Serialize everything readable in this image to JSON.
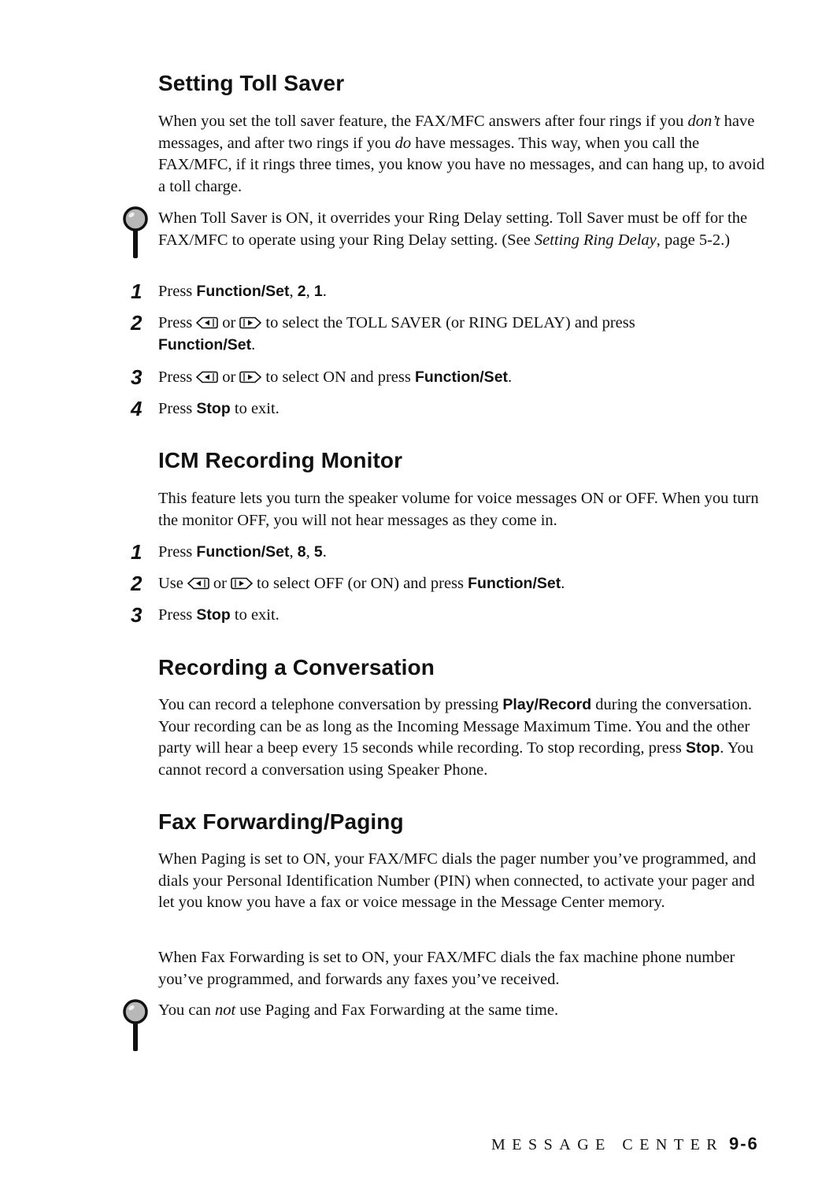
{
  "sections": [
    {
      "title": "Setting Toll Saver",
      "intro": {
        "p1": "When you set the toll saver feature, the FAX/MFC answers after four rings if you ",
        "em1": "don’t",
        "p2": " have messages, and after two rings if you ",
        "em2": "do",
        "p3": " have messages. This way, when you call the FAX/MFC, if it rings three times, you know you have no messages, and can hang up, to avoid a toll charge."
      },
      "note": {
        "p1": "When Toll Saver is ON, it overrides your Ring Delay setting. Toll Saver must be off for the FAX/MFC to operate using your Ring Delay setting. (See ",
        "em": "Setting Ring Delay",
        "p2": ", page 5-2.)"
      },
      "steps": [
        {
          "num": "1",
          "pre": "Press ",
          "bold": "Function/Set",
          "mid": ", ",
          "bold2": "2",
          "mid2": ", ",
          "bold3": "1",
          "post": "."
        },
        {
          "num": "2",
          "pre": "Press",
          "or": "or",
          "mid": "to select the TOLL SAVER (or RING DELAY) and press",
          "bold": "Function/Set",
          "post": "."
        },
        {
          "num": "3",
          "pre": "Press",
          "or": "or",
          "mid": "to select ON and press ",
          "bold": "Function/Set",
          "post": "."
        },
        {
          "num": "4",
          "pre": "Press ",
          "bold": "Stop",
          "post": " to exit."
        }
      ]
    },
    {
      "title": "ICM Recording Monitor",
      "intro": "This feature lets you turn the speaker volume for voice messages ON or OFF. When you turn the monitor OFF, you will not hear messages as they come in.",
      "steps": [
        {
          "num": "1",
          "pre": "Press ",
          "bold": "Function/Set",
          "mid": ", ",
          "bold2": "8",
          "mid2": ", ",
          "bold3": "5",
          "post": "."
        },
        {
          "num": "2",
          "pre": "Use",
          "or": "or",
          "mid": "to select OFF (or ON) and press ",
          "bold": "Function/Set",
          "post": "."
        },
        {
          "num": "3",
          "pre": "Press ",
          "bold": "Stop",
          "post": " to exit."
        }
      ]
    },
    {
      "title": "Recording a Conversation",
      "body": {
        "p1": "You can record a telephone conversation by pressing ",
        "b1": "Play/Record",
        "p2": " during the conversation. Your recording can be as long as the Incoming Message Maximum Time. You and the other party will hear a beep every 15 seconds while recording. To stop recording, press ",
        "b2": "Stop",
        "p3": ". You cannot record a conversation using Speaker Phone."
      }
    },
    {
      "title": "Fax Forwarding/Paging",
      "para1": "When Paging is set to ON, your FAX/MFC dials the pager number you’ve programmed, and dials your Personal Identification Number (PIN) when connected, to activate your pager and let you know you have a fax or voice message in the Message Center memory.",
      "para2": "When Fax Forwarding is set to ON, your FAX/MFC dials the fax machine phone number you’ve programmed, and forwards any faxes you’ve received.",
      "note": {
        "p1": "You can ",
        "em": "not",
        "p2": " use Paging and Fax Forwarding at the same time."
      }
    }
  ],
  "icons": {
    "note": "magnifier-note-icon",
    "left": "left-arrow-key-icon",
    "right": "right-arrow-key-icon"
  },
  "footer": {
    "chapter": "MESSAGE CENTER",
    "page": "9-6"
  }
}
